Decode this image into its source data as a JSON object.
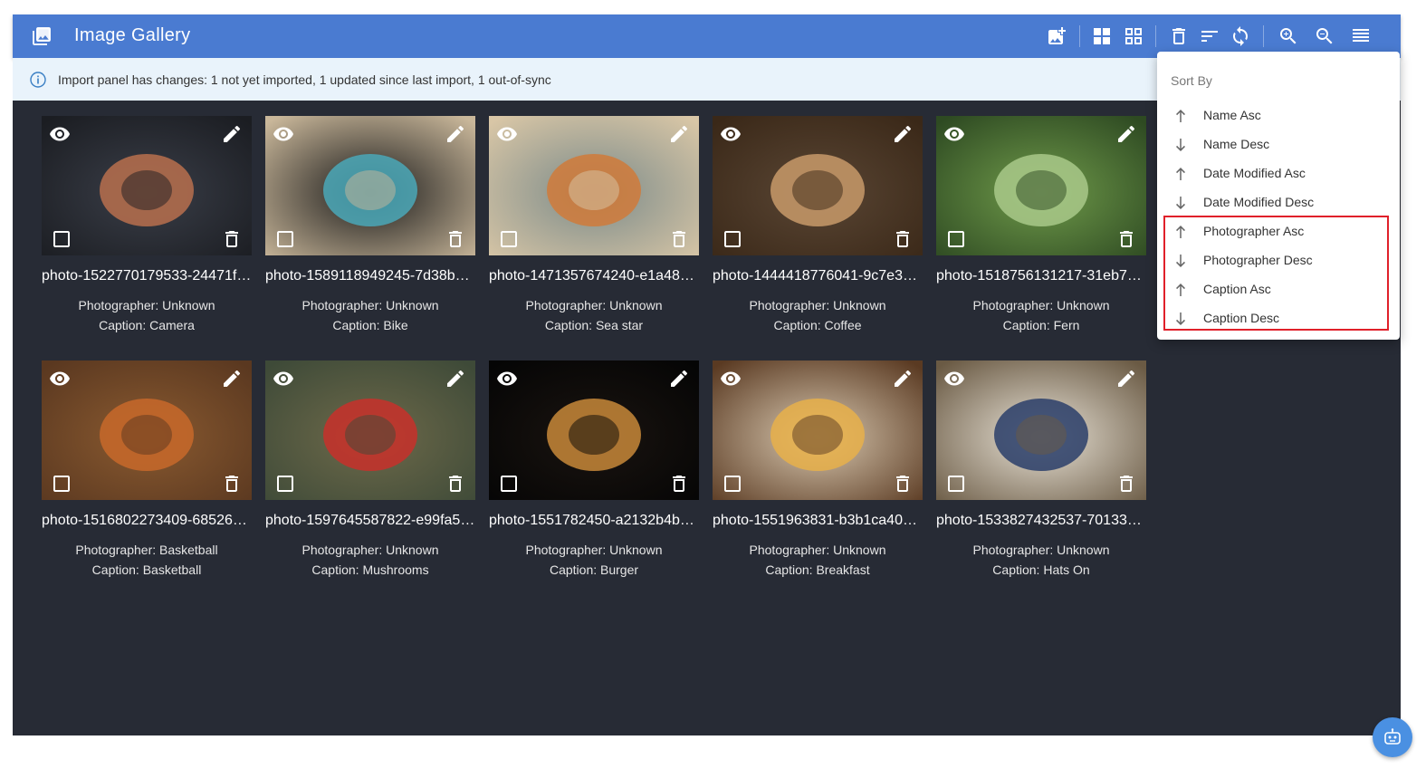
{
  "app": {
    "title": "Image Gallery"
  },
  "notice": {
    "text": "Import panel has changes: 1 not yet imported, 1 updated since last import, 1 out-of-sync"
  },
  "toolbar": {
    "buttons": [
      "add-image-icon",
      "large-grid-icon",
      "small-grid-icon",
      "delete-icon",
      "sort-icon",
      "sync-icon",
      "zoom-in-icon",
      "zoom-out-icon",
      "list-icon"
    ]
  },
  "sort_menu": {
    "header": "Sort By",
    "items": [
      {
        "label": "Name Asc",
        "dir": "up"
      },
      {
        "label": "Name Desc",
        "dir": "down"
      },
      {
        "label": "Date Modified Asc",
        "dir": "up"
      },
      {
        "label": "Date Modified Desc",
        "dir": "down"
      },
      {
        "label": "Photographer Asc",
        "dir": "up"
      },
      {
        "label": "Photographer Desc",
        "dir": "down"
      },
      {
        "label": "Caption Asc",
        "dir": "up"
      },
      {
        "label": "Caption Desc",
        "dir": "down"
      }
    ]
  },
  "gallery": {
    "cards": [
      {
        "name": "photo-1522770179533-24471f…",
        "photographer": "Photographer: Unknown",
        "caption": "Caption: Camera",
        "palette": [
          "#1b1d22",
          "#3a3e48",
          "#b8704e"
        ]
      },
      {
        "name": "photo-1589118949245-7d38b…",
        "photographer": "Photographer: Unknown",
        "caption": "Caption: Bike",
        "palette": [
          "#c9b79a",
          "#1a1a1a",
          "#4aa8b8"
        ]
      },
      {
        "name": "photo-1471357674240-e1a48…",
        "photographer": "Photographer: Unknown",
        "caption": "Caption: Sea star",
        "palette": [
          "#d8c6a6",
          "#7c8b8a",
          "#d07a3a"
        ]
      },
      {
        "name": "photo-1444418776041-9c7e3…",
        "photographer": "Photographer: Unknown",
        "caption": "Caption: Coffee",
        "palette": [
          "#3a2818",
          "#5a4634",
          "#c89a6a"
        ]
      },
      {
        "name": "photo-1518756131217-31eb7…",
        "photographer": "Photographer: Unknown",
        "caption": "Caption: Fern",
        "palette": [
          "#2e4a22",
          "#6f9a4a",
          "#a9c98a"
        ]
      },
      {
        "name": "photo-1516802273409-68526…",
        "photographer": "Photographer: Basketball",
        "caption": "Caption: Basketball",
        "palette": [
          "#5a3820",
          "#8a5a30",
          "#c8682a"
        ]
      },
      {
        "name": "photo-1597645587822-e99fa5…",
        "photographer": "Photographer: Unknown",
        "caption": "Caption: Mushrooms",
        "palette": [
          "#3e4a38",
          "#6e6a4a",
          "#c8302a"
        ]
      },
      {
        "name": "photo-1551782450-a2132b4b…",
        "photographer": "Photographer: Unknown",
        "caption": "Caption: Burger",
        "palette": [
          "#050505",
          "#1a1410",
          "#c8883a"
        ]
      },
      {
        "name": "photo-1551963831-b3b1ca40…",
        "photographer": "Photographer: Unknown",
        "caption": "Caption: Breakfast",
        "palette": [
          "#5a3a22",
          "#d8c8b0",
          "#e8b04a"
        ]
      },
      {
        "name": "photo-1533827432537-70133…",
        "photographer": "Photographer: Unknown",
        "caption": "Caption: Hats On",
        "palette": [
          "#6a5a44",
          "#e8e2d6",
          "#2a3e6a"
        ]
      }
    ]
  }
}
